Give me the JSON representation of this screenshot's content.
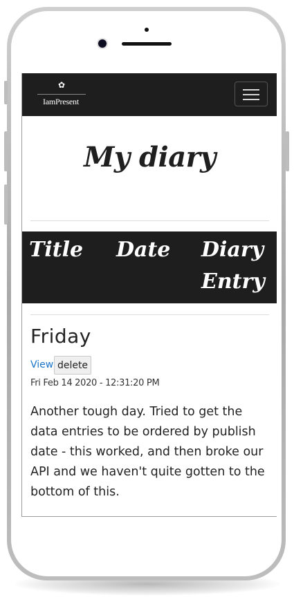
{
  "navbar": {
    "brand_mark": "✿",
    "brand_name": "IamPresent",
    "menu_icon": "hamburger-icon"
  },
  "page": {
    "title": "My diary"
  },
  "table": {
    "headers": [
      "Title",
      "Date",
      "Diary Entry"
    ]
  },
  "entries": [
    {
      "title": "Friday",
      "view_label": "View",
      "delete_label": "delete",
      "date": "Fri Feb 14 2020 - 12:31:20 PM",
      "body": "Another tough day. Tried to get the data entries to be ordered by publish date - this worked, and then broke our API and we haven't quite gotten to the bottom of this."
    }
  ],
  "colors": {
    "navbar_bg": "#1e1e1e",
    "header_bg": "#1e1e1e",
    "link": "#1a73c9",
    "frame": "#b5b5b5"
  }
}
